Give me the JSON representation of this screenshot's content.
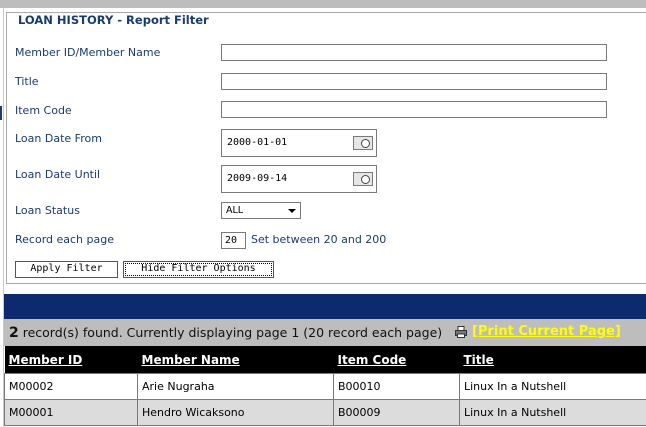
{
  "filter": {
    "legend": "LOAN HISTORY - Report Filter",
    "member_label": "Member ID/Member Name",
    "member_value": "",
    "title_label": "Title",
    "title_value": "",
    "item_code_label": "Item Code",
    "item_code_value": "",
    "loan_from_label": "Loan Date From",
    "loan_from_value": "2000-01-01",
    "loan_until_label": "Loan Date Until",
    "loan_until_value": "2009-09-14",
    "status_label": "Loan Status",
    "status_value": "ALL",
    "per_page_label": "Record each page",
    "per_page_value": "20",
    "per_page_hint": "Set between 20 and 200",
    "apply_button": "Apply Filter",
    "hide_button": "Hide Filter Options"
  },
  "results": {
    "count": "2",
    "summary": " record(s) found. Currently displaying page 1 (20 record each page)",
    "print_link": "[Print Current Page]",
    "columns": [
      "Member ID",
      "Member Name",
      "Item Code",
      "Title"
    ],
    "rows": [
      [
        "M00002",
        "Arie Nugraha",
        "B00010",
        "Linux In a Nutshell"
      ],
      [
        "M00001",
        "Hendro Wicaksono",
        "B00009",
        "Linux In a Nutshell"
      ]
    ]
  },
  "icons": {
    "calendar": "calendar-icon",
    "printer": "printer-icon",
    "dropdown": "chevron-down-icon"
  },
  "colors": {
    "nav": "#0d2a6e",
    "info_bar": "#bdbdbd",
    "print_link": "#ffff00",
    "label": "#1a3b6e"
  }
}
